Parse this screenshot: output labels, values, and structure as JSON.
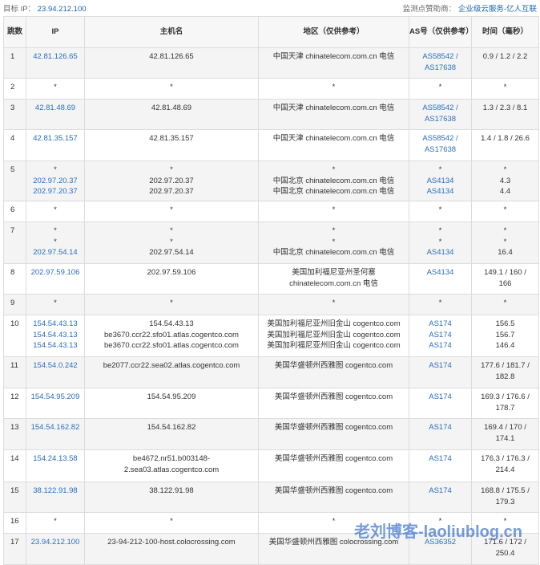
{
  "header": {
    "target_label": "目标 IP：",
    "target_ip": "23.94.212.100",
    "sponsor_label": "监测点赞助商：",
    "sponsor_name": "企业级云服务-亿人互联"
  },
  "columns": [
    "跳数",
    "IP",
    "主机名",
    "地区（仅供参考）",
    "AS号（仅供参考）",
    "时间（毫秒）"
  ],
  "rows": [
    {
      "hop": "1",
      "ip": [
        "42.81.126.65"
      ],
      "host": [
        "42.81.126.65"
      ],
      "region": [
        "中国天津 chinatelecom.com.cn 电信"
      ],
      "as": [
        "AS58542 /",
        "AS17638"
      ],
      "time": [
        "0.9 / 1.2 / 2.2"
      ]
    },
    {
      "hop": "2",
      "ip": [
        "*"
      ],
      "host": [
        "*"
      ],
      "region": [
        "*"
      ],
      "as": [
        "*"
      ],
      "time": [
        "*"
      ]
    },
    {
      "hop": "3",
      "ip": [
        "42.81.48.69"
      ],
      "host": [
        "42.81.48.69"
      ],
      "region": [
        "中国天津 chinatelecom.com.cn 电信"
      ],
      "as": [
        "AS58542 /",
        "AS17638"
      ],
      "time": [
        "1.3 / 2.3 / 8.1"
      ]
    },
    {
      "hop": "4",
      "ip": [
        "42.81.35.157"
      ],
      "host": [
        "42.81.35.157"
      ],
      "region": [
        "中国天津 chinatelecom.com.cn 电信"
      ],
      "as": [
        "AS58542 /",
        "AS17638"
      ],
      "time": [
        "1.4 / 1.8 / 26.6"
      ]
    },
    {
      "hop": "5",
      "ip": [
        "*",
        "202.97.20.37",
        "202.97.20.37"
      ],
      "host": [
        "*",
        "202.97.20.37",
        "202.97.20.37"
      ],
      "region": [
        "*",
        "中国北京 chinatelecom.com.cn 电信",
        "中国北京 chinatelecom.com.cn 电信"
      ],
      "as": [
        "*",
        "AS4134",
        "AS4134"
      ],
      "time": [
        "*",
        "4.3",
        "4.4"
      ]
    },
    {
      "hop": "6",
      "ip": [
        "*"
      ],
      "host": [
        "*"
      ],
      "region": [
        "*"
      ],
      "as": [
        "*"
      ],
      "time": [
        "*"
      ]
    },
    {
      "hop": "7",
      "ip": [
        "*",
        "*",
        "202.97.54.14"
      ],
      "host": [
        "*",
        "*",
        "202.97.54.14"
      ],
      "region": [
        "*",
        "*",
        "中国北京 chinatelecom.com.cn 电信"
      ],
      "as": [
        "*",
        "*",
        "AS4134"
      ],
      "time": [
        "*",
        "*",
        "16.4"
      ]
    },
    {
      "hop": "8",
      "ip": [
        "202.97.59.106"
      ],
      "host": [
        "202.97.59.106"
      ],
      "region": [
        "美国加利福尼亚州圣何塞",
        "chinatelecom.com.cn 电信"
      ],
      "as": [
        "AS4134"
      ],
      "time": [
        "149.1 / 160 /",
        "166"
      ]
    },
    {
      "hop": "9",
      "ip": [
        "*"
      ],
      "host": [
        "*"
      ],
      "region": [
        "*"
      ],
      "as": [
        "*"
      ],
      "time": [
        "*"
      ]
    },
    {
      "hop": "10",
      "ip": [
        "154.54.43.13",
        "154.54.43.13",
        "154.54.43.13"
      ],
      "host": [
        "154.54.43.13",
        "be3670.ccr22.sfo01.atlas.cogentco.com",
        "be3670.ccr22.sfo01.atlas.cogentco.com"
      ],
      "region": [
        "美国加利福尼亚州旧金山 cogentco.com",
        "美国加利福尼亚州旧金山 cogentco.com",
        "美国加利福尼亚州旧金山 cogentco.com"
      ],
      "as": [
        "AS174",
        "AS174",
        "AS174"
      ],
      "time": [
        "156.5",
        "156.7",
        "146.4"
      ]
    },
    {
      "hop": "11",
      "ip": [
        "154.54.0.242"
      ],
      "host": [
        "be2077.ccr22.sea02.atlas.cogentco.com"
      ],
      "region": [
        "美国华盛顿州西雅图 cogentco.com"
      ],
      "as": [
        "AS174"
      ],
      "time": [
        "177.6 / 181.7 /",
        "182.8"
      ]
    },
    {
      "hop": "12",
      "ip": [
        "154.54.95.209"
      ],
      "host": [
        "154.54.95.209"
      ],
      "region": [
        "美国华盛顿州西雅图 cogentco.com"
      ],
      "as": [
        "AS174"
      ],
      "time": [
        "169.3 / 176.6 /",
        "178.7"
      ]
    },
    {
      "hop": "13",
      "ip": [
        "154.54.162.82"
      ],
      "host": [
        "154.54.162.82"
      ],
      "region": [
        "美国华盛顿州西雅图 cogentco.com"
      ],
      "as": [
        "AS174"
      ],
      "time": [
        "169.4 / 170 /",
        "174.1"
      ]
    },
    {
      "hop": "14",
      "ip": [
        "154.24.13.58"
      ],
      "host": [
        "be4672.nr51.b003148-",
        "2.sea03.atlas.cogentco.com"
      ],
      "region": [
        "美国华盛顿州西雅图 cogentco.com"
      ],
      "as": [
        "AS174"
      ],
      "time": [
        "176.3 / 176.3 /",
        "214.4"
      ]
    },
    {
      "hop": "15",
      "ip": [
        "38.122.91.98"
      ],
      "host": [
        "38.122.91.98"
      ],
      "region": [
        "美国华盛顿州西雅图 cogentco.com"
      ],
      "as": [
        "AS174"
      ],
      "time": [
        "168.8 / 175.5 /",
        "179.3"
      ]
    },
    {
      "hop": "16",
      "ip": [
        "*"
      ],
      "host": [
        "*"
      ],
      "region": [
        "*"
      ],
      "as": [
        "*"
      ],
      "time": [
        "*"
      ]
    },
    {
      "hop": "17",
      "ip": [
        "23.94.212.100"
      ],
      "host": [
        "23-94-212-100-host.colocrossing.com"
      ],
      "region": [
        "美国华盛顿州西雅图 colocrossing.com"
      ],
      "as": [
        "AS36352"
      ],
      "time": [
        "171.6 / 172 /",
        "250.4"
      ]
    }
  ],
  "watermark": "老刘博客-laoliublog.cn"
}
